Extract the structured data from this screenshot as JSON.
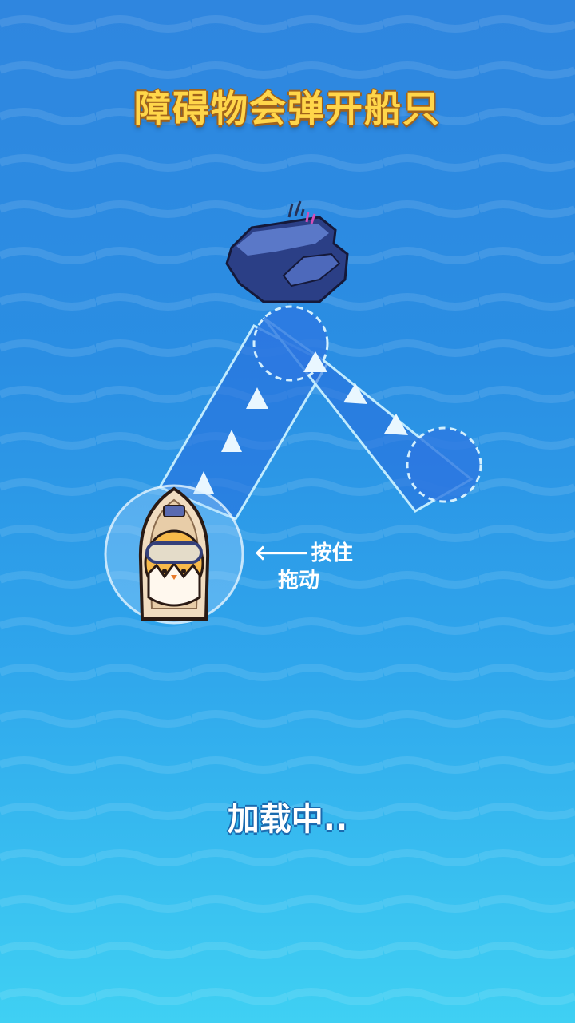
{
  "title": "障碍物会弹开船只",
  "hint": {
    "line1": "按住",
    "line2": "拖动",
    "arrow_icon": "arrow-left-icon"
  },
  "loading": "加载中..",
  "colors": {
    "sea_top": "#2f86df",
    "sea_bottom": "#3fd0f3",
    "title": "#ffd64a",
    "title_stroke": "#a0621b",
    "rock": "#3f57a8"
  }
}
